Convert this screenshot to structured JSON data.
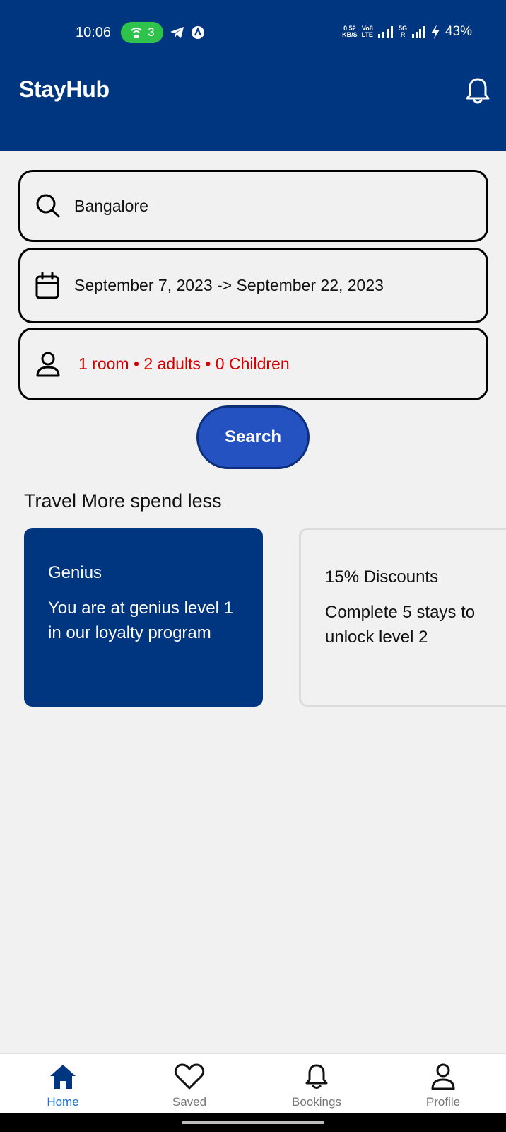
{
  "status_bar": {
    "time": "10:06",
    "hotspot_count": "3",
    "net_speed_top": "0.52",
    "net_speed_bottom": "KB/S",
    "volte_top": "Vo8",
    "volte_bottom": "LTE",
    "sim2_top": "5G",
    "sim2_bottom": "R",
    "battery": "43%"
  },
  "header": {
    "title": "StayHub",
    "notification_icon": "bell-icon"
  },
  "search_form": {
    "destination_value": "Bangalore",
    "destination_icon": "search-icon",
    "dates_value": "September 7, 2023 -> September 22, 2023",
    "dates_icon": "calendar-icon",
    "guests_value": "1 room • 2 adults • 0 Children",
    "guests_icon": "person-icon",
    "search_label": "Search"
  },
  "promo": {
    "section_title": "Travel More spend less",
    "cards": [
      {
        "title": "Genius",
        "description": "You are at genius level 1 in our loyalty program"
      },
      {
        "title": "15% Discounts",
        "description": "Complete 5 stays to unlock level 2"
      }
    ]
  },
  "bottom_nav": {
    "items": [
      {
        "label": "Home",
        "icon": "home-icon",
        "active": true
      },
      {
        "label": "Saved",
        "icon": "heart-icon",
        "active": false
      },
      {
        "label": "Bookings",
        "icon": "bell-icon",
        "active": false
      },
      {
        "label": "Profile",
        "icon": "person-icon",
        "active": false
      }
    ]
  },
  "colors": {
    "brand": "#003580",
    "accent_button": "#2452c1",
    "guests_text": "#d40000",
    "nav_active": "#1d6fd1",
    "background": "#f1f1f1"
  }
}
